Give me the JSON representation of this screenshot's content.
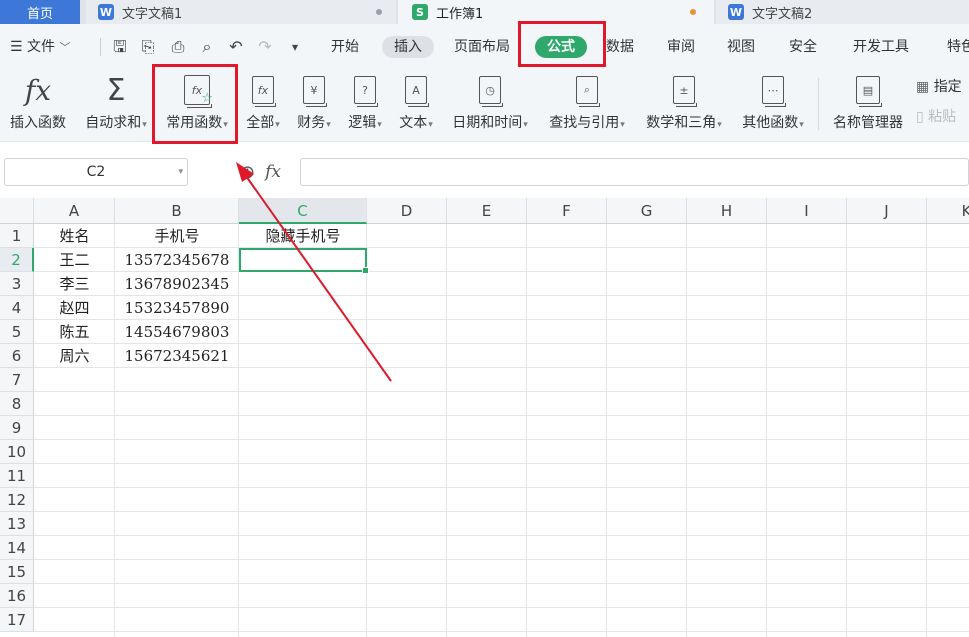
{
  "tabs": [
    {
      "label": "首页"
    },
    {
      "label": "文字文稿1",
      "badge": "W"
    },
    {
      "label": "工作簿1",
      "badge": "S"
    },
    {
      "label": "文字文稿2",
      "badge": "W"
    }
  ],
  "menu": {
    "file_label": "文件",
    "items": [
      "开始",
      "插入",
      "页面布局",
      "公式",
      "数据",
      "审阅",
      "视图",
      "安全",
      "开发工具",
      "特色"
    ]
  },
  "ribbon": {
    "buttons": [
      {
        "label": "插入函数",
        "icon": "fx-icon"
      },
      {
        "label": "自动求和",
        "icon": "sigma-icon"
      },
      {
        "label": "常用函数",
        "icon": "favorite-function-icon"
      },
      {
        "label": "全部",
        "icon": "all-functions-icon"
      },
      {
        "label": "财务",
        "icon": "yen-book-icon"
      },
      {
        "label": "逻辑",
        "icon": "question-book-icon"
      },
      {
        "label": "文本",
        "icon": "text-book-icon"
      },
      {
        "label": "日期和时间",
        "icon": "clock-book-icon"
      },
      {
        "label": "查找与引用",
        "icon": "search-book-icon"
      },
      {
        "label": "数学和三角",
        "icon": "math-book-icon"
      },
      {
        "label": "其他函数",
        "icon": "more-book-icon"
      },
      {
        "label": "名称管理器",
        "icon": "name-manager-icon"
      }
    ],
    "side_items": [
      "指定",
      "粘贴"
    ]
  },
  "formula_bar": {
    "name_box": "C2",
    "fx_label": "fx",
    "value": ""
  },
  "grid": {
    "columns": [
      "A",
      "B",
      "C",
      "D",
      "E",
      "F",
      "G",
      "H",
      "I",
      "J",
      "K"
    ],
    "rows": [
      "1",
      "2",
      "3",
      "4",
      "5",
      "6",
      "7",
      "8",
      "9",
      "10",
      "11",
      "12",
      "13",
      "14",
      "15",
      "16",
      "17"
    ],
    "selected_cell": "C2",
    "data": [
      [
        "姓名",
        "手机号",
        "隐藏手机号"
      ],
      [
        "王二",
        "13572345678",
        ""
      ],
      [
        "李三",
        "13678902345",
        ""
      ],
      [
        "赵四",
        "15323457890",
        ""
      ],
      [
        "陈五",
        "14554679803",
        ""
      ],
      [
        "周六",
        "15672345621",
        ""
      ]
    ]
  },
  "colors": {
    "accent_green": "#2ea96b",
    "highlight_red": "#e0182b",
    "tab_blue": "#3d78d8"
  }
}
